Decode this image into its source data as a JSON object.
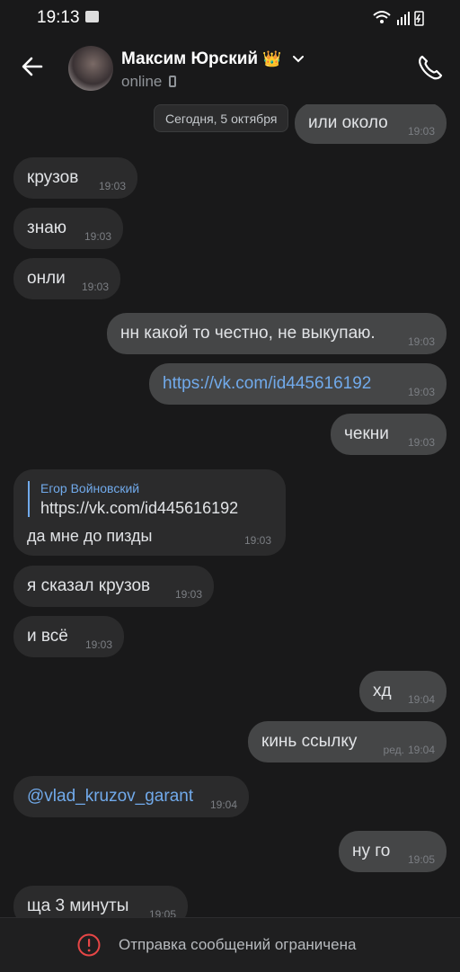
{
  "status_bar": {
    "time": "19:13"
  },
  "header": {
    "contact_name": "Максим Юрский",
    "crown": "👑",
    "status": "online",
    "icons": [
      "back-arrow-icon",
      "chevron-down-icon",
      "mobile-device-icon",
      "phone-call-icon"
    ]
  },
  "date_separator": "Сегодня, 5 октября",
  "messages": [
    {
      "text": "или около",
      "time": "19:03",
      "outgoing": true
    },
    {
      "text": "крузов",
      "time": "19:03",
      "outgoing": false
    },
    {
      "text": "знаю",
      "time": "19:03",
      "outgoing": false
    },
    {
      "text": "онли",
      "time": "19:03",
      "outgoing": false
    },
    {
      "text": "нн какой то честно, не выкупаю.",
      "time": "19:03",
      "outgoing": true
    },
    {
      "text": "https://vk.com/id445616192",
      "time": "19:03",
      "outgoing": true
    },
    {
      "text": "чекни",
      "time": "19:03",
      "outgoing": true
    },
    {
      "reply_author": "Егор Войновский",
      "reply_text": "https://vk.com/id445616192",
      "text": "да мне до пизды",
      "time": "19:03",
      "outgoing": false
    },
    {
      "text": "я сказал крузов",
      "time": "19:03",
      "outgoing": false
    },
    {
      "text": "и всё",
      "time": "19:03",
      "outgoing": false
    },
    {
      "text": "хд",
      "time": "19:04",
      "outgoing": true
    },
    {
      "text": "кинь ссылку",
      "time": "19:04",
      "edited_label": "ред.",
      "outgoing": true
    },
    {
      "text": "@vlad_kruzov_garant",
      "time": "19:04",
      "outgoing": false
    },
    {
      "text": "ну го",
      "time": "19:05",
      "outgoing": true
    },
    {
      "text": "ща 3 минуты",
      "time": "19:05",
      "outgoing": false
    }
  ],
  "bottom_notice": "Отправка сообщений ограничена",
  "colors": {
    "background": "#19191a",
    "incoming_bubble": "#2b2b2c",
    "outgoing_bubble": "#454647",
    "link": "#71aaeb",
    "warning": "#e64646"
  }
}
